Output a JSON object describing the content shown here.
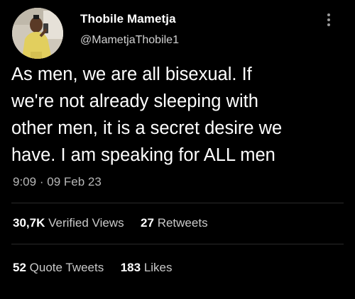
{
  "author": {
    "name": "Thobile Mametja",
    "handle": "@MametjaThobile1"
  },
  "tweet": {
    "lines": [
      "As men, we are all bisexual. If",
      "we're not already sleeping with",
      "other men, it is a secret desire we",
      "have. I am speaking for ALL men"
    ],
    "time": "9:09",
    "separator": "·",
    "date": "09 Feb 23"
  },
  "stats": {
    "views_count": "30,7K",
    "views_label": "Verified Views",
    "retweets_count": "27",
    "retweets_label": "Retweets",
    "quotes_count": "52",
    "quotes_label": "Quote Tweets",
    "likes_count": "183",
    "likes_label": "Likes"
  },
  "icons": {
    "more": "more-options-icon",
    "avatar": "profile-photo"
  },
  "colors": {
    "background": "#000000",
    "primary_text": "#ffffff",
    "secondary_text": "#b7b7b7"
  }
}
